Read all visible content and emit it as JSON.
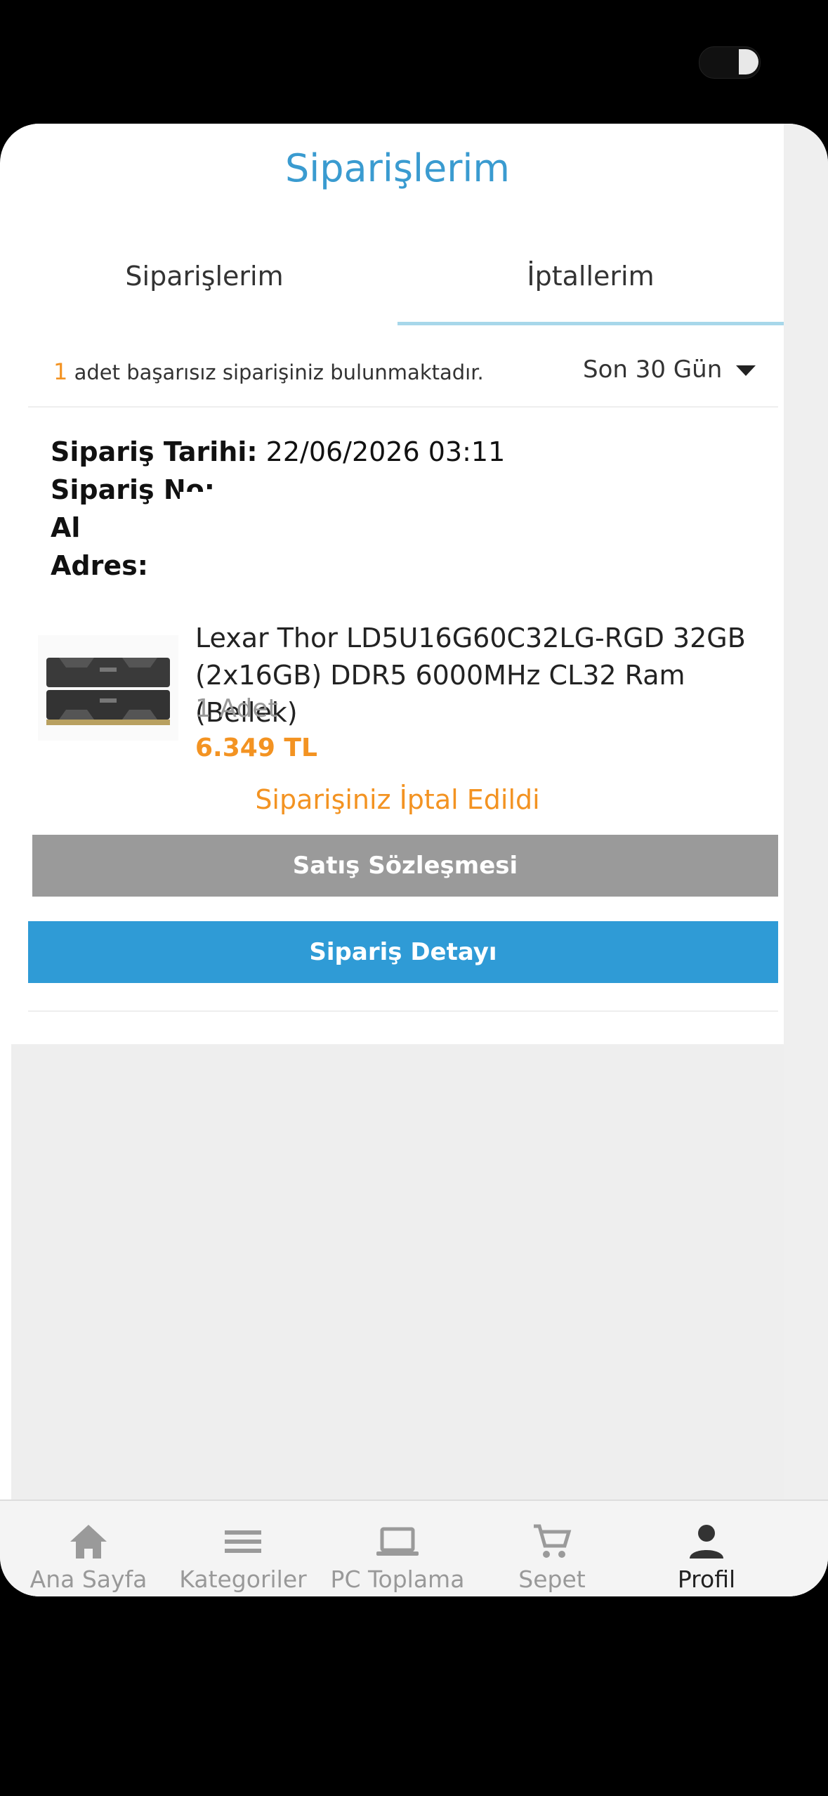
{
  "header": {
    "title": "Siparişlerim"
  },
  "tabs": [
    {
      "label": "Siparişlerim"
    },
    {
      "label": "İptallerim"
    }
  ],
  "summary": {
    "count": "1",
    "text": " adet başarısız siparişiniz bulunmaktadır.",
    "period": "Son 30 Gün"
  },
  "order": {
    "date_label": "Sipariş Tarihi:",
    "date_value": "22/06/2026 03:11",
    "no_label": "Sipariş No:",
    "buyer_label": "Al",
    "address_label": "Adres:",
    "product": {
      "name": "Lexar Thor LD5U16G60C32LG-RGD 32GB (2x16GB) DDR5 6000MHz CL32 Ram (Bellek)",
      "qty": "1 Adet",
      "price": "6.349 TL"
    },
    "status": "Siparişiniz İptal Edildi",
    "contract_button": "Satış Sözleşmesi",
    "detail_button": "Sipariş Detayı"
  },
  "bottom_nav": [
    {
      "label": "Ana Sayfa",
      "icon": "home-icon"
    },
    {
      "label": "Kategoriler",
      "icon": "menu-icon"
    },
    {
      "label": "PC Toplama",
      "icon": "laptop-icon"
    },
    {
      "label": "Sepet",
      "icon": "cart-icon"
    },
    {
      "label": "Profil",
      "icon": "person-icon"
    }
  ],
  "colors": {
    "accent": "#3a9bd0",
    "orange": "#f39322",
    "button_blue": "#2f9bd6",
    "button_gray": "#9a9a9a"
  }
}
